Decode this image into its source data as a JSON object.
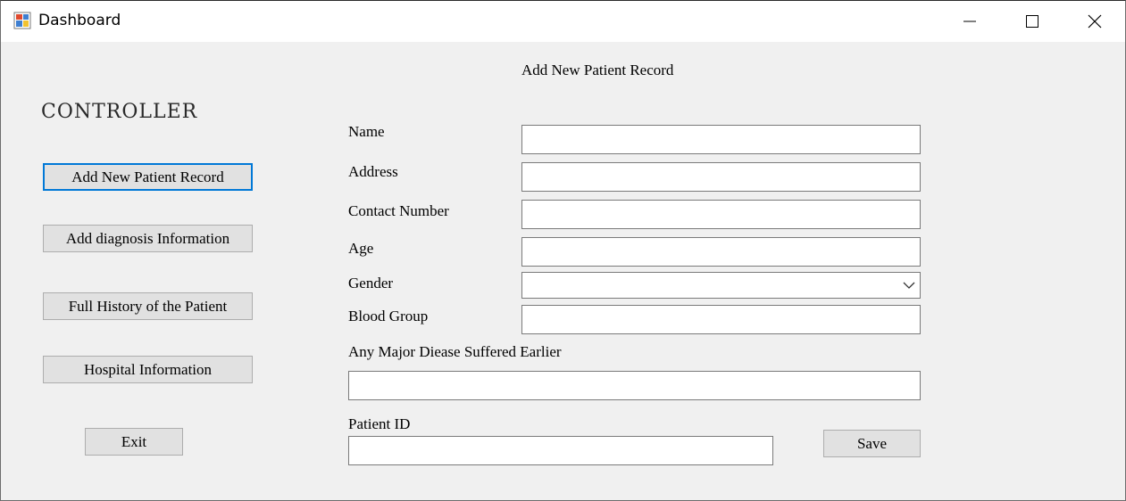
{
  "window": {
    "title": "Dashboard",
    "icons": {
      "app": "app-window-icon",
      "minimize": "minimize-icon",
      "maximize": "maximize-icon",
      "close": "close-icon"
    }
  },
  "sidebar": {
    "heading": "CONTROLLER",
    "buttons": {
      "add_patient": "Add New Patient Record",
      "add_diagnosis": "Add diagnosis Information",
      "full_history": "Full History of the Patient",
      "hospital_info": "Hospital Information",
      "exit": "Exit"
    }
  },
  "form": {
    "heading": "Add New Patient Record",
    "fields": {
      "name": {
        "label": "Name",
        "value": ""
      },
      "address": {
        "label": "Address",
        "value": ""
      },
      "contact": {
        "label": "Contact Number",
        "value": ""
      },
      "age": {
        "label": "Age",
        "value": ""
      },
      "gender": {
        "label": "Gender",
        "value": ""
      },
      "blood_group": {
        "label": "Blood Group",
        "value": ""
      },
      "major_disease": {
        "label": "Any Major Diease Suffered Earlier",
        "value": ""
      },
      "patient_id": {
        "label": "Patient ID",
        "value": ""
      }
    },
    "save_label": "Save"
  },
  "colors": {
    "window_bg": "#f0f0f0",
    "titlebar_bg": "#ffffff",
    "button_bg": "#e1e1e1",
    "button_border": "#adadad",
    "focus_border": "#0078d7",
    "input_border": "#7a7a7a"
  }
}
